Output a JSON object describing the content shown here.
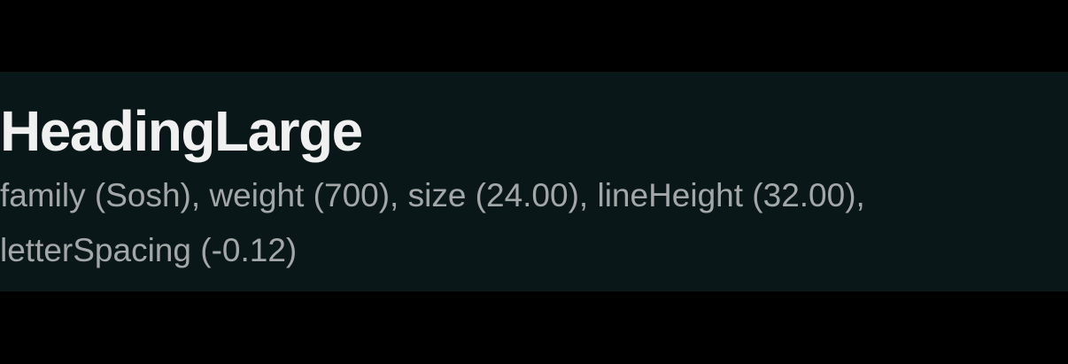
{
  "token": {
    "name": "HeadingLarge",
    "description": "family (Sosh), weight (700), size (24.00), lineHeight (32.00), letterSpacing (-0.12)"
  },
  "colors": {
    "page_background": "#000000",
    "panel_background": "#0a1719",
    "title_text": "#f0f0f0",
    "description_text": "#a3a7a8"
  }
}
